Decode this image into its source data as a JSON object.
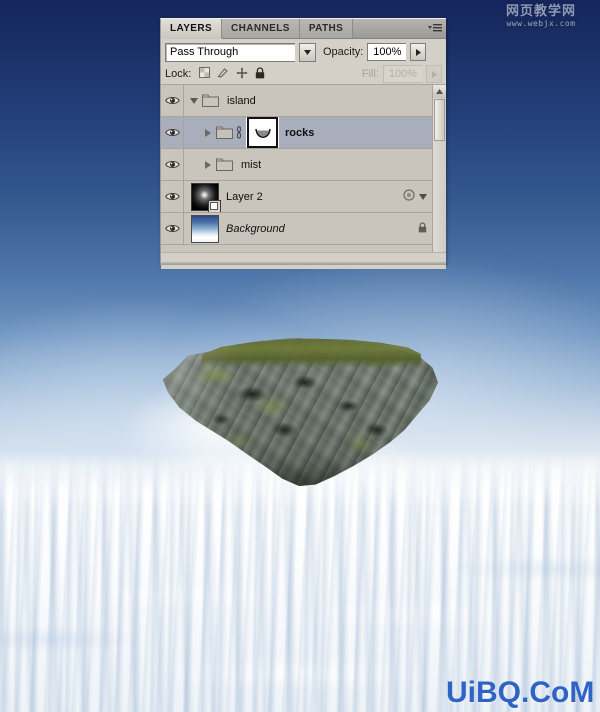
{
  "scene": {
    "description_alt": "Floating rock island above a sea of clouds",
    "sky_top_color": "#14255c",
    "sky_bottom_color": "#ffffff",
    "island_label": "floating-rock-island"
  },
  "watermark_top": {
    "text_cn": "网页教学网",
    "url": "www.webjx.com"
  },
  "watermark_bottom": {
    "text": "UiBQ.CoM",
    "color": "#2f63c4"
  },
  "panel": {
    "tabs": [
      {
        "label": "LAYERS",
        "active": true
      },
      {
        "label": "CHANNELS",
        "active": false
      },
      {
        "label": "PATHS",
        "active": false
      }
    ],
    "menu_icon": "panel-menu-icon",
    "blend_mode": {
      "value": "Pass Through",
      "arrow_icon": "chevron-down-icon"
    },
    "opacity": {
      "label": "Opacity:",
      "value": "100%",
      "arrow_icon": "chevron-right-icon"
    },
    "lock": {
      "label": "Lock:",
      "icons": [
        "lock-transparent-pixels-icon",
        "lock-image-pixels-icon",
        "lock-position-icon",
        "lock-all-icon"
      ]
    },
    "fill": {
      "label": "Fill:",
      "value": "100%",
      "arrow_icon": "chevron-right-icon"
    },
    "layers": [
      {
        "name": "island",
        "type": "group",
        "visible": true,
        "expanded": true,
        "selected": false,
        "indent": 0,
        "style": "normal"
      },
      {
        "name": "rocks",
        "type": "group",
        "visible": true,
        "expanded": false,
        "selected": true,
        "indent": 1,
        "style": "bold",
        "has_link": true,
        "thumbnail": "vector-mask-thumbnail"
      },
      {
        "name": "mist",
        "type": "group",
        "visible": true,
        "expanded": false,
        "selected": false,
        "indent": 1,
        "style": "normal"
      },
      {
        "name": "Layer 2",
        "type": "layer",
        "visible": true,
        "selected": false,
        "indent": 0,
        "style": "normal",
        "thumbnail": "glow-thumbnail",
        "right_icons": [
          "fx-circle-icon",
          "expand-triangle-icon"
        ]
      },
      {
        "name": "Background",
        "type": "layer",
        "visible": true,
        "selected": false,
        "indent": 0,
        "style": "italic",
        "thumbnail": "sky-thumbnail",
        "right_icons": [
          "lock-icon"
        ]
      }
    ],
    "scrollbar": {
      "up_icon": "scroll-up-arrow-icon"
    }
  }
}
